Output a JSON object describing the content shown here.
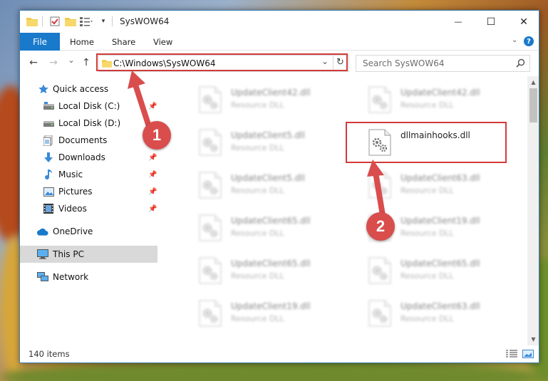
{
  "window": {
    "title": "SysWOW64",
    "minimize": "—",
    "maximize": "☐",
    "close": "✕"
  },
  "ribbon": {
    "tabs": [
      "File",
      "Home",
      "Share",
      "View"
    ],
    "help": "?"
  },
  "nav": {
    "back": "←",
    "forward": "→",
    "recent": "⌄",
    "up": "↑",
    "address": "C:\\Windows\\SysWOW64",
    "dropdown": "⌄",
    "refresh": "↻",
    "search_placeholder": "Search SysWOW64"
  },
  "sidebar": {
    "items": [
      {
        "label": "Quick access",
        "icon": "star-icon"
      },
      {
        "label": "Local Disk (C:)",
        "icon": "drive-icon"
      },
      {
        "label": "Local Disk (D:)",
        "icon": "drive-icon"
      },
      {
        "label": "Documents",
        "icon": "documents-icon"
      },
      {
        "label": "Downloads",
        "icon": "download-icon"
      },
      {
        "label": "Music",
        "icon": "music-icon"
      },
      {
        "label": "Pictures",
        "icon": "pictures-icon"
      },
      {
        "label": "Videos",
        "icon": "videos-icon"
      },
      {
        "label": "OneDrive",
        "icon": "cloud-icon"
      },
      {
        "label": "This PC",
        "icon": "computer-icon"
      },
      {
        "label": "Network",
        "icon": "network-icon"
      }
    ]
  },
  "files": {
    "left": [
      {
        "name": "UpdateClient42.dll",
        "type": "Resource DLL"
      },
      {
        "name": "UpdateClient5.dll",
        "type": "Resource DLL"
      },
      {
        "name": "UpdateClient5.dll",
        "type": "Resource DLL"
      },
      {
        "name": "UpdateClient65.dll",
        "type": "Resource DLL"
      },
      {
        "name": "UpdateClient65.dll",
        "type": "Resource DLL"
      },
      {
        "name": "UpdateClient19.dll",
        "type": "Resource DLL"
      }
    ],
    "right": [
      {
        "name": "UpdateClient42.dll",
        "type": "Resource DLL"
      },
      {
        "name": "dllmainhooks.dll",
        "type": ""
      },
      {
        "name": "UpdateClient63.dll",
        "type": "Resource DLL"
      },
      {
        "name": "UpdateClient19.dll",
        "type": "Resource DLL"
      },
      {
        "name": "UpdateClient65.dll",
        "type": "Resource DLL"
      },
      {
        "name": "UpdateClient63.dll",
        "type": "Resource DLL"
      }
    ]
  },
  "status": {
    "count": "140 items"
  },
  "annotations": {
    "step1": "1",
    "step2": "2",
    "color": "#d94d4d"
  },
  "colors": {
    "accent": "#1979ca",
    "selected_bg": "#d9d9d9"
  }
}
